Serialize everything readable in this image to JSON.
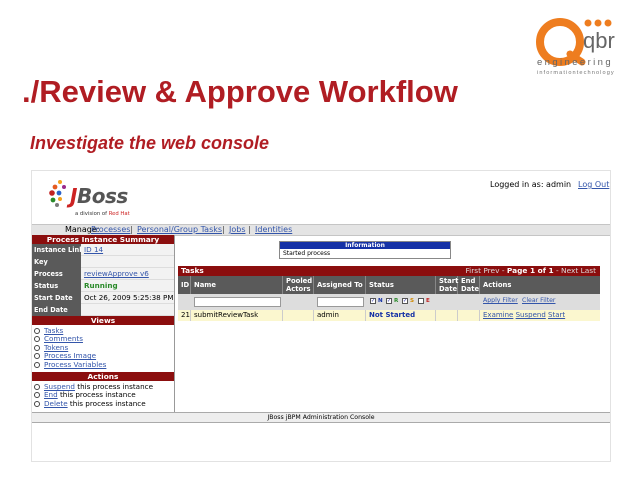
{
  "slide": {
    "title": "./Review & Approve Workflow",
    "subtitle": "Investigate the web console"
  },
  "logo": {
    "word": "qbr",
    "line1": "engineering",
    "line2": "informationtechnology"
  },
  "console": {
    "brand": {
      "name_j": "J",
      "name_rest": "Boss",
      "tag_prefix": "a division of ",
      "tag_redhat": "Red Hat"
    },
    "header": {
      "logged_in": "Logged in as: admin",
      "logout": "Log Out"
    },
    "nav": {
      "manage": "Manage:",
      "items": [
        "Processes",
        "Personal/Group Tasks",
        "Jobs",
        "Identities"
      ],
      "sep": "|"
    },
    "summary": {
      "title": "Process Instance Summary",
      "rows": [
        {
          "key": "Instance Link",
          "value": "ID 14"
        },
        {
          "key": "Key",
          "value": ""
        },
        {
          "key": "Process",
          "value": "reviewApprove v6"
        },
        {
          "key": "Status",
          "value": "Running"
        },
        {
          "key": "Start Date",
          "value": "Oct 26, 2009 5:25:38 PM"
        },
        {
          "key": "End Date",
          "value": ""
        }
      ]
    },
    "views": {
      "title": "Views",
      "items": [
        "Tasks",
        "Comments",
        "Tokens",
        "Process Image",
        "Process Variables"
      ]
    },
    "actions": {
      "title": "Actions",
      "items": [
        {
          "link": "Suspend",
          "rest": " this process instance"
        },
        {
          "link": "End",
          "rest": " this process instance"
        },
        {
          "link": "Delete",
          "rest": " this process instance"
        }
      ]
    },
    "info": {
      "title": "Information",
      "message": "Started process"
    },
    "tasks": {
      "title": "Tasks",
      "pager_first_prev": "First Prev - ",
      "pager_page": "Page 1 of 1",
      "pager_next_last": " - Next Last",
      "columns": [
        "ID",
        "Name",
        "Pooled Actors",
        "Assigned To",
        "Status",
        "Start Date",
        "End Date",
        "Actions"
      ],
      "status_filters": [
        "N",
        "R",
        "S",
        "E"
      ],
      "status_colors": {
        "N": "#1531a6",
        "R": "#2a8a2a",
        "S": "#d08a00",
        "E": "#c22222"
      },
      "apply_filter": "Apply Filter",
      "clear_filter": "Clear Filter",
      "row": {
        "id": "21",
        "name": "submitReviewTask",
        "pooled": "",
        "assigned": "admin",
        "status": "Not Started",
        "start": "",
        "end": "",
        "actions": [
          "Examine",
          "Suspend",
          "Start"
        ]
      }
    },
    "footer": "JBoss jBPM Administration Console"
  }
}
